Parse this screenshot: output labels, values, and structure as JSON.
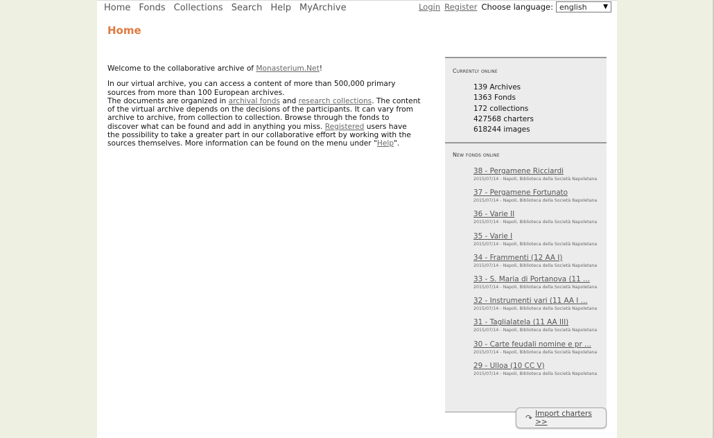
{
  "nav": {
    "items": [
      "Home",
      "Fonds",
      "Collections",
      "Search",
      "Help",
      "MyArchive"
    ]
  },
  "userbar": {
    "login": "Login",
    "register": "Register",
    "language_label": "Choose language:",
    "language_value": "english"
  },
  "page": {
    "title": "Home"
  },
  "content": {
    "welcome_pre": "Welcome to the collaborative archive of ",
    "welcome_link": "Monasterium.Net",
    "welcome_post": "!",
    "p2_1": "In our virtual archive, you can access a content of more than 500,000 primary sources from more than 100 European archives.",
    "p2_2": "The documents are organized in ",
    "p2_link1": "archival fonds",
    "p2_3": " and ",
    "p2_link2": "research collections",
    "p2_4": ". The content of the virtual archive depends on the decisions of the participants. It can vary from archive to archive, from collection to collection. Browse through the fonds to discover what can be found and add in anything you miss. ",
    "p2_link3": "Registered",
    "p2_5": " users have the possibility to take a greater part in our collaborative effort by working with the sources themselves. More information can be found on the menu under \"",
    "p2_link4": "Help",
    "p2_6": "\"."
  },
  "sidebar": {
    "online_heading": "Currently online",
    "stats": [
      "139 Archives",
      "1363 Fonds",
      "172 collections",
      "427568 charters",
      "618244 images"
    ],
    "new_fonds_heading": "New fonds online",
    "fonds": [
      {
        "title": "38 - Pergamene Ricciardi",
        "meta": "2015/07/14 - Napoli, Biblioteca della Società Napoletana"
      },
      {
        "title": "37 - Pergamene Fortunato",
        "meta": "2015/07/14 - Napoli, Biblioteca della Società Napoletana"
      },
      {
        "title": "36 - Varie II",
        "meta": "2015/07/14 - Napoli, Biblioteca della Società Napoletana"
      },
      {
        "title": "35 - Varie I",
        "meta": "2015/07/14 - Napoli, Biblioteca della Società Napoletana"
      },
      {
        "title": "34 - Frammenti (12 AA I)",
        "meta": "2015/07/14 - Napoli, Biblioteca della Società Napoletana"
      },
      {
        "title": "33 - S. Maria di Portanova (11 ...",
        "meta": "2015/07/14 - Napoli, Biblioteca della Società Napoletana"
      },
      {
        "title": "32 - Instrumenti vari (11 AA I ...",
        "meta": "2015/07/14 - Napoli, Biblioteca della Società Napoletana"
      },
      {
        "title": "31 - Taglialatela (11 AA III)",
        "meta": "2015/07/14 - Napoli, Biblioteca della Società Napoletana"
      },
      {
        "title": "30 - Carte feudali nomine e pr ...",
        "meta": "2015/07/14 - Napoli, Biblioteca della Società Napoletana"
      },
      {
        "title": "29 - Ulloa (10 CC V)",
        "meta": "2015/07/14 - Napoli, Biblioteca della Società Napoletana"
      }
    ],
    "import_label": "Import charters >>"
  },
  "colors": {
    "title": "#e07a40",
    "background": "#eef0e2",
    "sidebar": "#ececec"
  }
}
